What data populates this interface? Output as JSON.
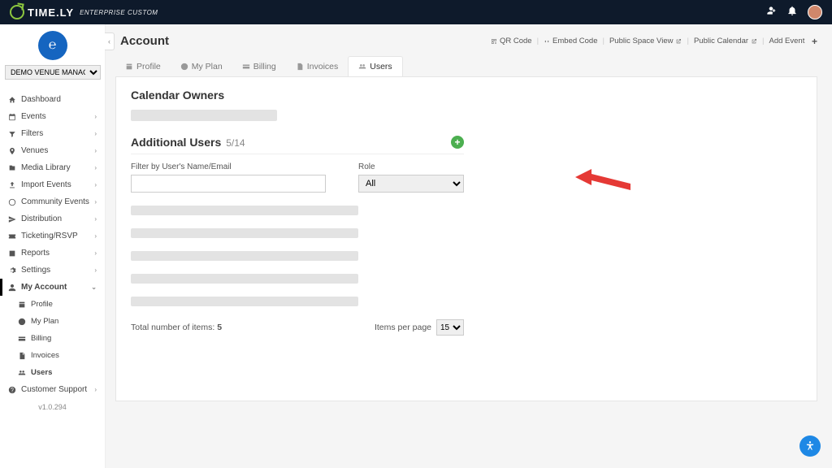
{
  "brand": {
    "name": "TIME.LY",
    "tier": "ENTERPRISE CUSTOM"
  },
  "org": {
    "selector": "DEMO VENUE MANAGEMENT"
  },
  "sidebar": {
    "items": [
      {
        "label": "Dashboard"
      },
      {
        "label": "Events"
      },
      {
        "label": "Filters"
      },
      {
        "label": "Venues"
      },
      {
        "label": "Media Library"
      },
      {
        "label": "Import Events"
      },
      {
        "label": "Community Events"
      },
      {
        "label": "Distribution"
      },
      {
        "label": "Ticketing/RSVP"
      },
      {
        "label": "Reports"
      },
      {
        "label": "Settings"
      }
    ],
    "account": {
      "label": "My Account",
      "children": [
        {
          "label": "Profile"
        },
        {
          "label": "My Plan"
        },
        {
          "label": "Billing"
        },
        {
          "label": "Invoices"
        },
        {
          "label": "Users"
        }
      ]
    },
    "support": {
      "label": "Customer Support"
    },
    "version": "v1.0.294"
  },
  "header": {
    "title": "Account",
    "actions": {
      "qr": "QR Code",
      "embed": "Embed Code",
      "public_space": "Public Space View",
      "public_cal": "Public Calendar",
      "add_event": "Add Event"
    }
  },
  "tabs": [
    {
      "label": "Profile"
    },
    {
      "label": "My Plan"
    },
    {
      "label": "Billing"
    },
    {
      "label": "Invoices"
    },
    {
      "label": "Users"
    }
  ],
  "owners": {
    "title": "Calendar Owners"
  },
  "additional": {
    "title": "Additional Users",
    "count": "5/14",
    "filter_label": "Filter by User's Name/Email",
    "role_label": "Role",
    "role_options": [
      "All"
    ],
    "role_selected": "All"
  },
  "pager": {
    "total_label": "Total number of items:",
    "total_value": "5",
    "ipp_label": "Items per page",
    "ipp_value": "15"
  }
}
